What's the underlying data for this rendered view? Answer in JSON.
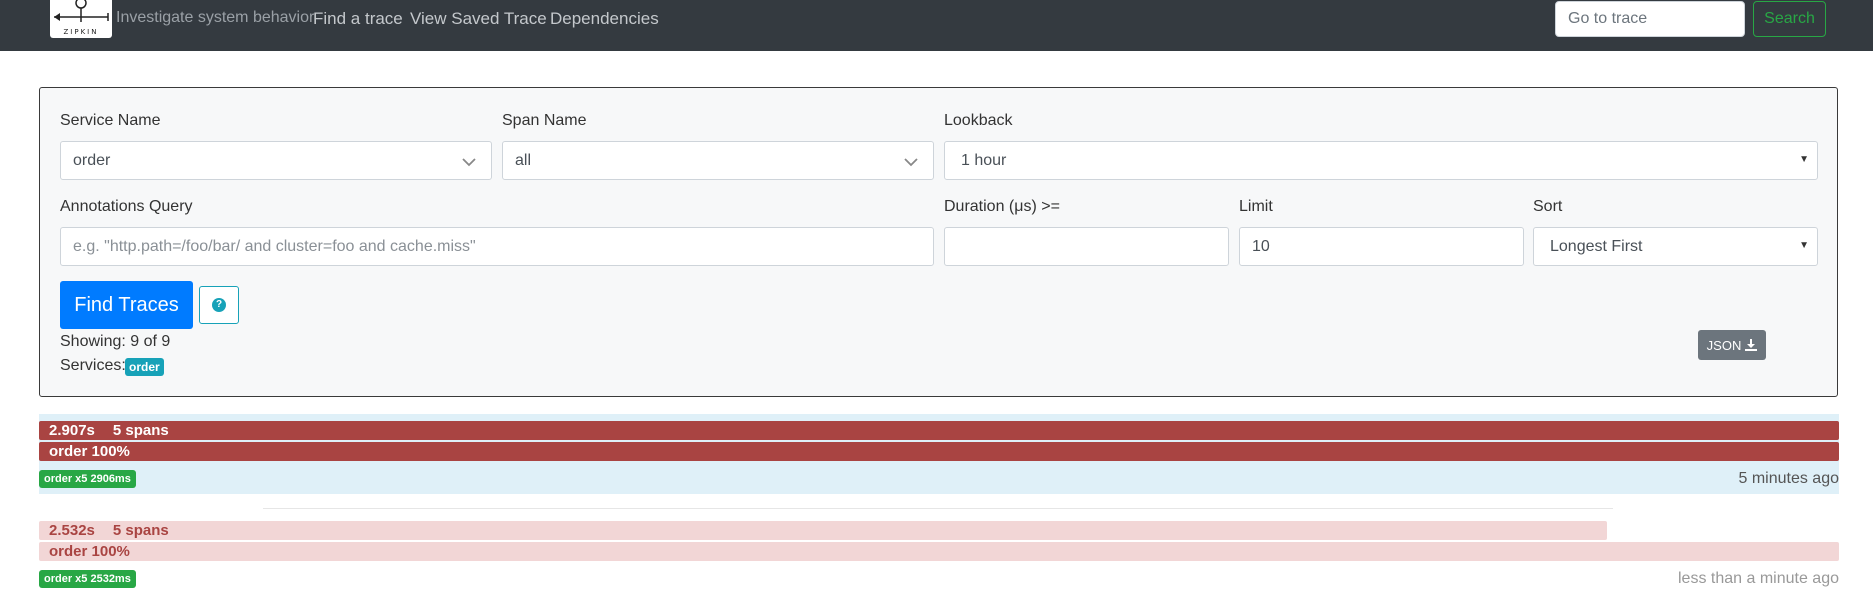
{
  "navbar": {
    "logo_text": "ZIPKIN",
    "tagline": "Investigate system behavior",
    "links": [
      "Find a trace",
      "View Saved Trace",
      "Dependencies"
    ],
    "goto_placeholder": "Go to trace",
    "search_label": "Search"
  },
  "form": {
    "service_name_label": "Service Name",
    "service_name_value": "order",
    "span_name_label": "Span Name",
    "span_name_value": "all",
    "lookback_label": "Lookback",
    "lookback_value": "1 hour",
    "annotations_label": "Annotations Query",
    "annotations_placeholder": "e.g. \"http.path=/foo/bar/ and cluster=foo and cache.miss\"",
    "duration_label": "Duration (μs) >=",
    "duration_value": "",
    "limit_label": "Limit",
    "limit_value": "10",
    "sort_label": "Sort",
    "sort_value": "Longest First",
    "find_label": "Find Traces",
    "help_glyph": "?",
    "showing": "Showing: 9 of 9",
    "services_label": "Services:",
    "service_badge": "order",
    "json_label": "JSON"
  },
  "traces": [
    {
      "duration": "2.907s",
      "spans": "5 spans",
      "service_pct": "order 100%",
      "badge": "order x5 2906ms",
      "ago": "5 minutes ago",
      "width_pct": 100,
      "colors": {
        "bar": "#a94442",
        "row": "#dff0f8",
        "text": "#ffffff",
        "ago": "#555555"
      }
    },
    {
      "duration": "2.532s",
      "spans": "5 spans",
      "service_pct": "order 100%",
      "badge": "order x5 2532ms",
      "ago": "less than a minute ago",
      "width_pct": 87.1,
      "colors": {
        "bar": "#f2d6d6",
        "row": "#ffffff",
        "text": "#a94442",
        "ago": "#999999"
      }
    }
  ],
  "colors": {
    "navbar": "#343a40",
    "primary": "#007bff",
    "success": "#28a745",
    "info": "#17a2b8",
    "secondary": "#6c757d"
  }
}
